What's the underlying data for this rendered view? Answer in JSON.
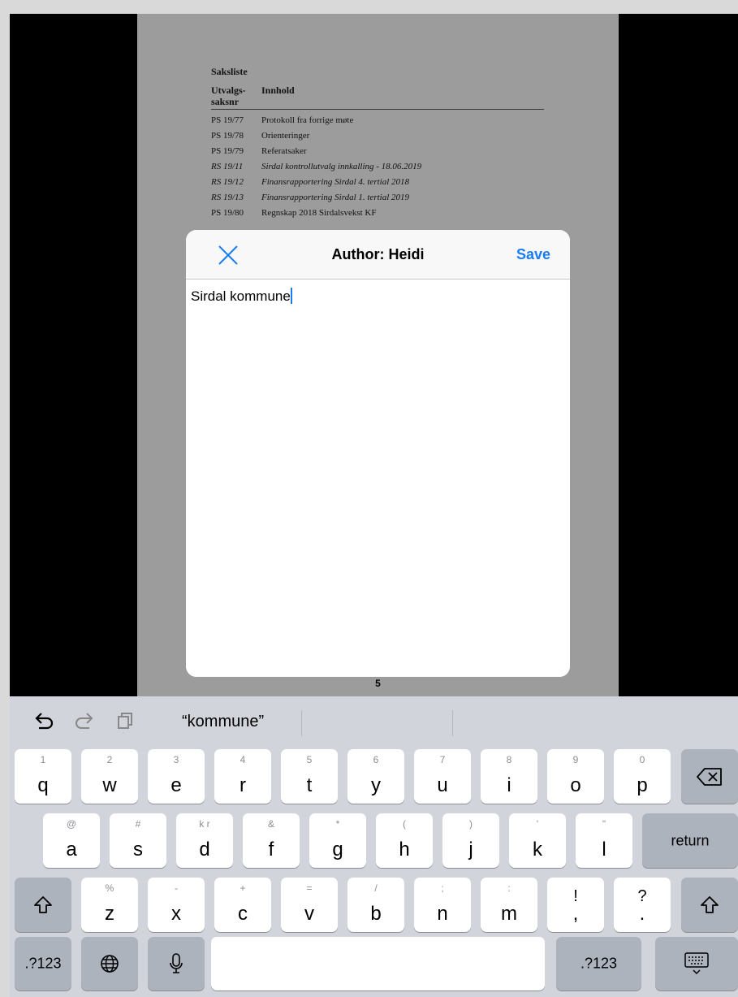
{
  "document": {
    "title": "Saksliste",
    "col1_header": "Utvalgs-\nsaksnr",
    "col2_header": "Innhold",
    "rows": [
      {
        "num": "PS 19/77",
        "text": "Protokoll fra forrige møte"
      },
      {
        "num": "PS 19/78",
        "text": "Orienteringer"
      },
      {
        "num": "PS 19/79",
        "text": "Referatsaker"
      },
      {
        "num": "RS 19/11",
        "text": "Sirdal kontrollutvalg innkalling -  18.06.2019"
      },
      {
        "num": "RS 19/12",
        "text": "Finansrapportering Sirdal 4. tertial 2018"
      },
      {
        "num": "RS 19/13",
        "text": "Finansrapportering Sirdal 1. tertial 2019"
      },
      {
        "num": "PS 19/80",
        "text": "Regnskap 2018 Sirdalsvekst KF"
      }
    ],
    "page_number": "5"
  },
  "dialog": {
    "title": "Author: Heidi",
    "save_label": "Save",
    "note_text": "Sirdal kommune"
  },
  "keyboard": {
    "suggestion": "“kommune”",
    "row1": [
      {
        "main": "q",
        "sub": "1"
      },
      {
        "main": "w",
        "sub": "2"
      },
      {
        "main": "e",
        "sub": "3"
      },
      {
        "main": "r",
        "sub": "4"
      },
      {
        "main": "t",
        "sub": "5"
      },
      {
        "main": "y",
        "sub": "6"
      },
      {
        "main": "u",
        "sub": "7"
      },
      {
        "main": "i",
        "sub": "8"
      },
      {
        "main": "o",
        "sub": "9"
      },
      {
        "main": "p",
        "sub": "0"
      }
    ],
    "row2": [
      {
        "main": "a",
        "sub": "@"
      },
      {
        "main": "s",
        "sub": "#"
      },
      {
        "main": "d",
        "sub": "k r"
      },
      {
        "main": "f",
        "sub": "&"
      },
      {
        "main": "g",
        "sub": "*"
      },
      {
        "main": "h",
        "sub": "("
      },
      {
        "main": "j",
        "sub": ")"
      },
      {
        "main": "k",
        "sub": "'"
      },
      {
        "main": "l",
        "sub": "\""
      }
    ],
    "row3": [
      {
        "main": "z",
        "sub": "%"
      },
      {
        "main": "x",
        "sub": "-"
      },
      {
        "main": "c",
        "sub": "+"
      },
      {
        "main": "v",
        "sub": "="
      },
      {
        "main": "b",
        "sub": "/"
      },
      {
        "main": "n",
        "sub": ";"
      },
      {
        "main": "m",
        "sub": ":"
      },
      {
        "main": ",",
        "sub": "!"
      },
      {
        "main": ".",
        "sub": "?"
      }
    ],
    "return_label": "return",
    "numbers_label": ".?123"
  },
  "colors": {
    "accent": "#1a7cf5",
    "keyboard_bg": "#d1d4da",
    "dark_key": "#adb3bd"
  }
}
